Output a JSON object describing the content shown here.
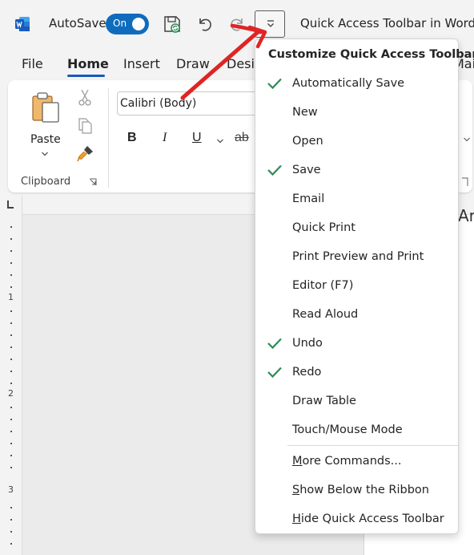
{
  "titlebar": {
    "autosave_label": "AutoSave",
    "toggle_state": "On",
    "document_title": "Quick Access Toolbar in Word.docx",
    "icons": [
      "word-logo-icon",
      "save-icon",
      "undo-icon",
      "redo-icon",
      "chevron-down-icon"
    ]
  },
  "tabs": [
    {
      "label": "File"
    },
    {
      "label": "Home",
      "active": true
    },
    {
      "label": "Insert"
    },
    {
      "label": "Draw"
    },
    {
      "label": "Design"
    },
    {
      "label": "Mailings"
    }
  ],
  "ribbon": {
    "paste_label": "Paste",
    "clipboard_group_label": "Clipboard",
    "font_name": "Calibri (Body)",
    "bold": "B",
    "italic": "I",
    "underline": "U",
    "strikethrough": "ab"
  },
  "document": {
    "ruler_numbers": [
      "1",
      "2",
      "3"
    ],
    "page_text": "Ar"
  },
  "menu": {
    "title": "Customize Quick Access Toolbar",
    "items": [
      {
        "label": "Automatically Save",
        "checked": true
      },
      {
        "label": "New",
        "checked": false
      },
      {
        "label": "Open",
        "checked": false
      },
      {
        "label": "Save",
        "checked": true
      },
      {
        "label": "Email",
        "checked": false
      },
      {
        "label": "Quick Print",
        "checked": false
      },
      {
        "label": "Print Preview and Print",
        "checked": false
      },
      {
        "label": "Editor (F7)",
        "checked": false
      },
      {
        "label": "Read Aloud",
        "checked": false
      },
      {
        "label": "Undo",
        "checked": true
      },
      {
        "label": "Redo",
        "checked": true
      },
      {
        "label": "Draw Table",
        "checked": false
      },
      {
        "label": "Touch/Mouse Mode",
        "checked": false
      }
    ],
    "footer_items": [
      {
        "label": "More Commands..."
      },
      {
        "label": "Show Below the Ribbon"
      },
      {
        "label": "Hide Quick Access Toolbar"
      }
    ]
  },
  "colors": {
    "accent": "#0f6cbd",
    "check": "#2e8b57",
    "annotation_arrow": "#e02424",
    "tab_underline": "#185abd"
  }
}
